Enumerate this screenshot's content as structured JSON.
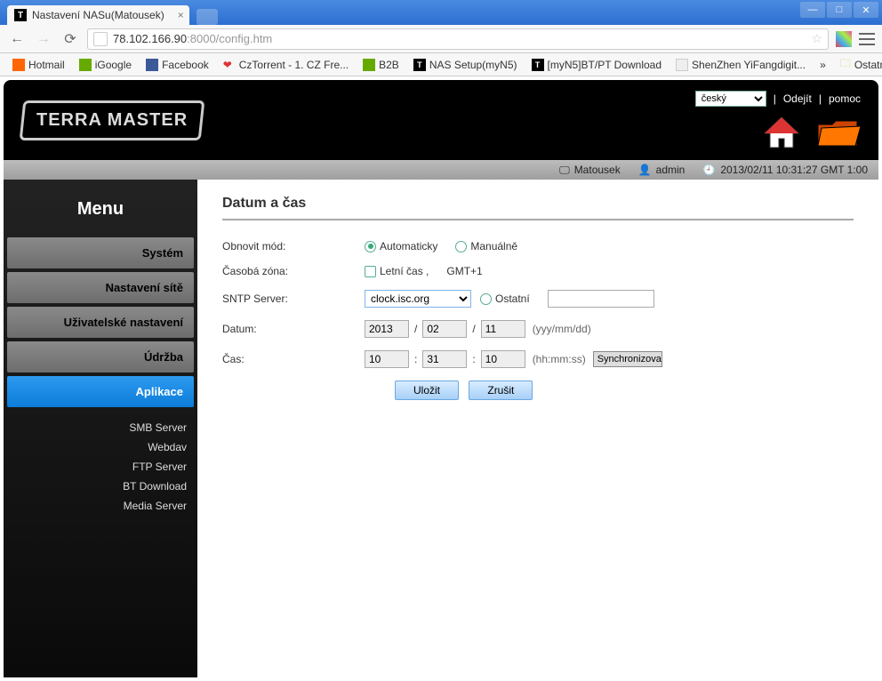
{
  "browser": {
    "tab_title": "Nastavení NASu(Matousek)",
    "url_domain": "78.102.166.90",
    "url_rest": ":8000/config.htm"
  },
  "bookmarks": {
    "items": [
      "Hotmail",
      "iGoogle",
      "Facebook",
      "CzTorrent - 1. CZ Fre...",
      "B2B",
      "NAS Setup(myN5)",
      "[myN5]BT/PT Download",
      "ShenZhen YiFangdigit..."
    ],
    "other": "Ostatní záložky"
  },
  "header": {
    "logo": "TERRA MASTER",
    "lang": "český",
    "logout": "Odejít",
    "help": "pomoc"
  },
  "statusbar": {
    "device": "Matousek",
    "user": "admin",
    "datetime": "2013/02/11 10:31:27 GMT 1:00"
  },
  "sidebar": {
    "title": "Menu",
    "items": [
      "Systém",
      "Nastavení sítě",
      "Uživatelské nastavení",
      "Údržba",
      "Aplikace"
    ],
    "submenu": [
      "SMB Server",
      "Webdav",
      "FTP Server",
      "BT Download",
      "Media Server"
    ]
  },
  "panel": {
    "title": "Datum a čas",
    "labels": {
      "refresh_mode": "Obnovit mód:",
      "auto": "Automaticky",
      "manual": "Manuálně",
      "timezone": "Časobá zóna:",
      "dst": "Letní čas ,",
      "gmt": "GMT+1",
      "sntp": "SNTP Server:",
      "sntp_value": "clock.isc.org",
      "other": "Ostatní",
      "date": "Datum:",
      "time": "Čas:",
      "date_hint": "(yyy/mm/dd)",
      "time_hint": "(hh:mm:ss)",
      "sync": "Synchronizovat",
      "save": "Uložit",
      "cancel": "Zrušit"
    },
    "date": {
      "y": "2013",
      "m": "02",
      "d": "11"
    },
    "time": {
      "h": "10",
      "m": "31",
      "s": "10"
    }
  }
}
